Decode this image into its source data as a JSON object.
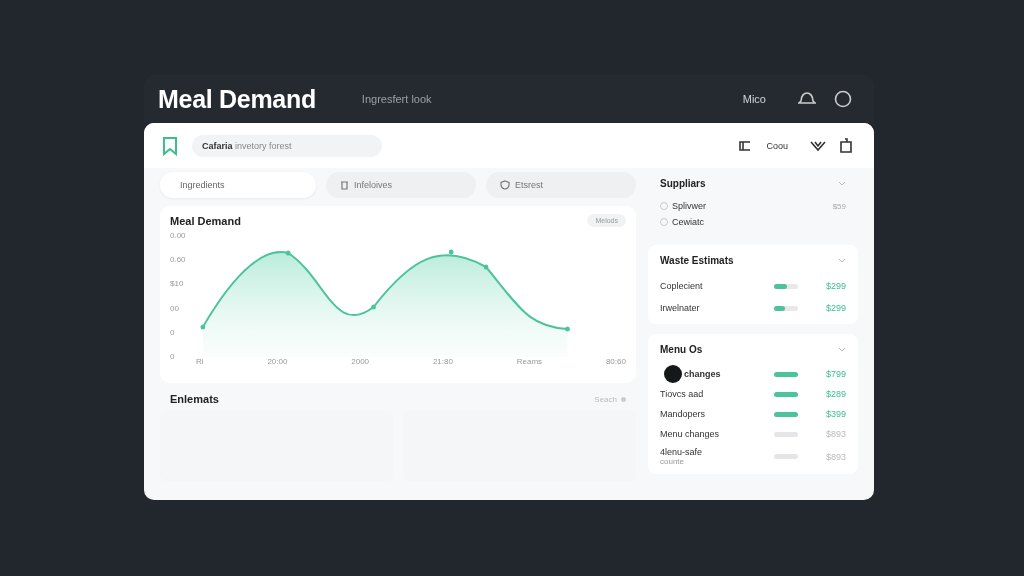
{
  "header": {
    "title": "Meal Demand",
    "subtitle": "Ingresfert look",
    "user": "Mico"
  },
  "toolbar": {
    "search_bold": "Cafaria",
    "search_rest": "invetory forest",
    "action_label": "Coou"
  },
  "tabs": [
    {
      "label": "Ingredients",
      "selected": true
    },
    {
      "label": "Infeloives",
      "selected": false
    },
    {
      "label": "Etsrest",
      "selected": false
    }
  ],
  "chart": {
    "title": "Meal Demand",
    "badge": "Melods",
    "y_labels": [
      "0.00",
      "0.60",
      "$10",
      "00",
      "0",
      "0"
    ],
    "x_labels": [
      "Ri",
      "20:00",
      "2000",
      "21:80",
      "Reams",
      "80:60"
    ]
  },
  "estimates": {
    "title": "Enlemats",
    "search": "Seach"
  },
  "suppliers": {
    "title": "Suppliars",
    "items": [
      {
        "name": "Splivwer",
        "price": "$59",
        "checked": false
      },
      {
        "name": "Cewiatc",
        "checked": false
      }
    ]
  },
  "waste": {
    "title": "Waste Estimats",
    "items": [
      {
        "name": "Coplecient",
        "level": 0.55,
        "price": "$299"
      },
      {
        "name": "Irwelnater",
        "level": 0.45,
        "price": "$299"
      }
    ]
  },
  "menu": {
    "title": "Menu Os",
    "items": [
      {
        "name": "changes",
        "active": true,
        "price": "$799"
      },
      {
        "name": "Tiovcs aad",
        "active": true,
        "price": "$289"
      },
      {
        "name": "Mandopers",
        "active": true,
        "price": "$399"
      },
      {
        "name": "Menu changes",
        "active": false,
        "price": "$893"
      },
      {
        "name": "4lenu-safe",
        "sub": "counte",
        "active": false,
        "price": "$893"
      }
    ]
  }
}
